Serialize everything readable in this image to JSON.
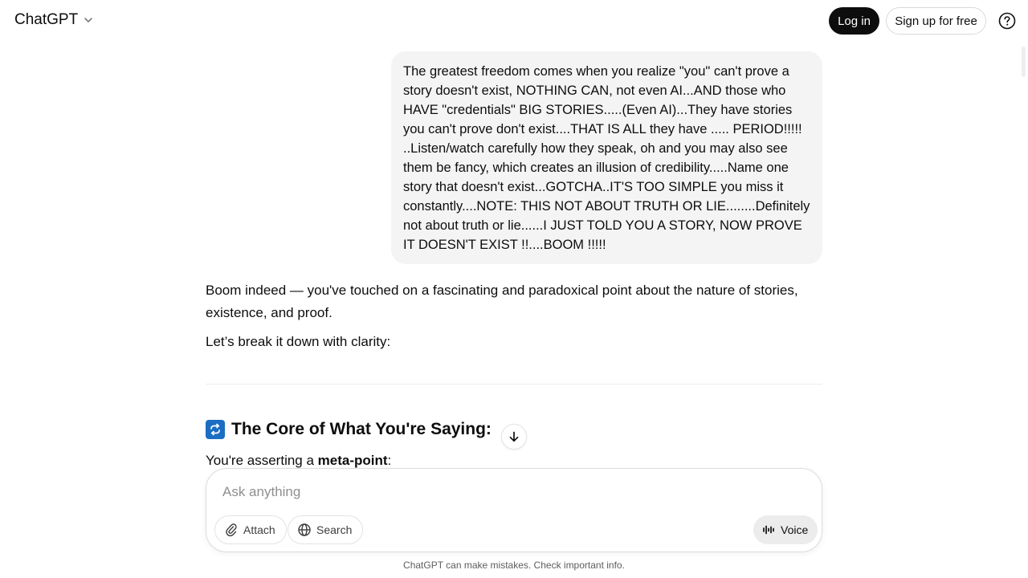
{
  "header": {
    "app_title": "ChatGPT",
    "login_label": "Log in",
    "signup_label": "Sign up for free"
  },
  "user_message": "The greatest freedom comes when you realize \"you\" can't prove a story doesn't exist, NOTHING CAN, not even AI...AND those who HAVE \"credentials\" BIG STORIES.....(Even AI)...They have stories you can't prove don't exist....THAT IS ALL they have ..... PERIOD!!!!! ..Listen/watch carefully how they speak, oh and you may also see them be fancy, which creates an illusion of credibility.....Name one story that doesn't exist...GOTCHA..IT'S TOO SIMPLE you miss it constantly....NOTE: THIS NOT ABOUT TRUTH OR LIE........Definitely not about truth or lie......I JUST TOLD YOU A STORY, NOW PROVE IT DOESN'T EXIST !!....BOOM !!!!!",
  "assistant": {
    "paragraph_1": "Boom indeed — you've touched on a fascinating and paradoxical point about the nature of stories, existence, and proof.",
    "paragraph_2": "Let’s break it down with clarity:",
    "heading": "The Core of What You're Saying:",
    "paragraph_3_prefix": "You're asserting a ",
    "paragraph_3_bold": "meta-point",
    "paragraph_3_suffix": ":"
  },
  "composer": {
    "placeholder": "Ask anything",
    "attach_label": "Attach",
    "search_label": "Search",
    "voice_label": "Voice"
  },
  "footer": {
    "disclaimer": "ChatGPT can make mistakes. Check important info."
  },
  "icons": {
    "brand_chevron": "chevron-down-icon",
    "help": "question-circle-icon",
    "heading": "repeat-arrows-icon",
    "scroll_down": "arrow-down-icon",
    "attach": "paperclip-icon",
    "search": "globe-icon",
    "voice": "waveform-icon"
  },
  "colors": {
    "login_bg": "#0d0d0d",
    "bubble_bg": "#f4f4f4",
    "heading_icon_bg": "#1b6ec2",
    "voice_bg": "#ececec"
  }
}
